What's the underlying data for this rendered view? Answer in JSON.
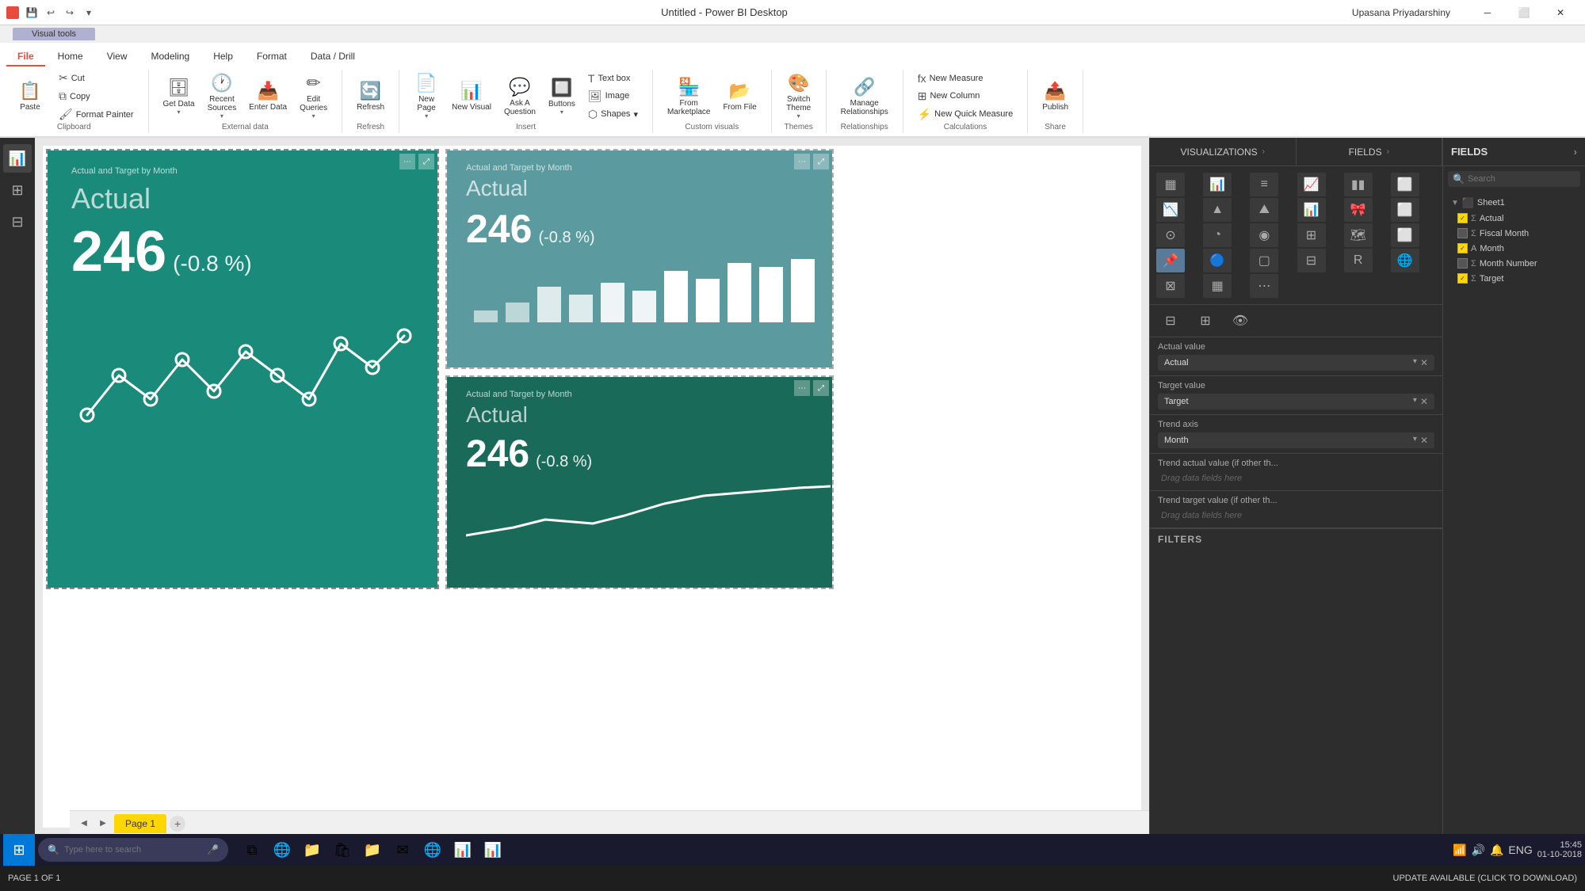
{
  "titlebar": {
    "app_icon": "⬛",
    "title": "Untitled - Power BI Desktop",
    "quick_access": [
      "💾",
      "↩",
      "↪",
      "▾"
    ],
    "visual_tools_tab": "Visual tools",
    "win_min": "─",
    "win_max": "⬜",
    "win_close": "✕",
    "user": "Upasana Priyadarshiny"
  },
  "ribbon_tabs": [
    "File",
    "Home",
    "View",
    "Modeling",
    "Help",
    "Format",
    "Data / Drill"
  ],
  "ribbon_active_tab": "Home",
  "ribbon_groups": {
    "clipboard": {
      "label": "Clipboard",
      "paste": "Paste",
      "cut": "Cut",
      "copy": "Copy",
      "format_painter": "Format Painter"
    },
    "external_data": {
      "label": "External data",
      "get_data": "Get Data",
      "recent_sources": "Recent Sources",
      "enter_data": "Enter Data",
      "edit_queries": "Edit Queries"
    },
    "refresh": {
      "label": "Refresh",
      "btn": "Refresh"
    },
    "insert": {
      "label": "Insert",
      "new_page": "New Page",
      "new_visual": "New Visual",
      "ask_question": "Ask A Question",
      "buttons": "Buttons",
      "text_box": "Text box",
      "image": "Image",
      "shapes": "Shapes"
    },
    "custom_visuals": {
      "label": "Custom visuals",
      "from_marketplace": "From Marketplace",
      "from_file": "From File"
    },
    "themes": {
      "label": "Themes",
      "switch_theme": "Switch Theme"
    },
    "relationships": {
      "label": "Relationships",
      "manage": "Manage Relationships"
    },
    "calculations": {
      "label": "Calculations",
      "new_measure": "New Measure",
      "new_column": "New Column",
      "new_quick_measure": "New Quick Measure"
    },
    "share": {
      "label": "Share",
      "publish": "Publish"
    }
  },
  "charts": {
    "chart1": {
      "title": "Actual and Target by Month",
      "metric_label": "Actual",
      "value": "246",
      "pct": "(-0.8 %)"
    },
    "chart2": {
      "title": "Actual and Target by Month",
      "metric_label": "Actual",
      "value": "246",
      "pct": "(-0.8 %)"
    },
    "chart3": {
      "title": "Actual and Target by Month",
      "metric_label": "Actual",
      "value": "246",
      "pct": "(-0.8 %)"
    }
  },
  "visualizations": {
    "panel_label": "VISUALIZATIONS",
    "expand_icon": "›",
    "icons": [
      "📊",
      "📈",
      "📋",
      "📉",
      "▦",
      "≡",
      "🔵",
      "⬤",
      "⬜",
      "📦",
      "🗺",
      "⊞",
      "R",
      "🌐",
      "⊟",
      "📌",
      "⬚",
      "▦",
      "≋",
      "🗃",
      "📊",
      "✦"
    ],
    "bottom_icons": [
      "⊟",
      "⊞",
      "👁"
    ],
    "actual_value_label": "Actual value",
    "actual_value_field": "Actual",
    "target_value_label": "Target value",
    "target_value_field": "Target",
    "trend_axis_label": "Trend axis",
    "trend_axis_field": "Month",
    "trend_actual_label": "Trend actual value (if other th...",
    "trend_actual_placeholder": "Drag data fields here",
    "trend_target_label": "Trend target value (if other th...",
    "trend_target_placeholder": "Drag data fields here"
  },
  "fields_panel": {
    "label": "FIELDS",
    "expand_icon": "›",
    "search_placeholder": "Search",
    "tree": {
      "sheet1_label": "Sheet1",
      "items": [
        {
          "name": "Actual",
          "checked": true,
          "type": "sigma"
        },
        {
          "name": "Fiscal Month",
          "checked": false,
          "type": "sigma"
        },
        {
          "name": "Month",
          "checked": true,
          "type": "text"
        },
        {
          "name": "Month Number",
          "checked": false,
          "type": "sigma"
        },
        {
          "name": "Target",
          "checked": true,
          "type": "sigma"
        }
      ]
    }
  },
  "filters_label": "FILTERS",
  "page_bar": {
    "page_label": "Page 1",
    "add_page_icon": "+"
  },
  "status_bar": {
    "page_info": "PAGE 1 OF 1",
    "update_msg": "UPDATE AVAILABLE (CLICK TO DOWNLOAD)"
  },
  "taskbar": {
    "search_placeholder": "Type here to search",
    "time": "15:45",
    "date": "01-10-2018",
    "apps": [
      "🌐",
      "📁",
      "🛍",
      "📁",
      "✉",
      "🌐",
      "📊",
      "📊"
    ]
  },
  "colors": {
    "chart1_bg": "#1a8a7a",
    "chart2_bg": "#5b9ba0",
    "chart3_bg": "#1a6a5a",
    "titlebar_bg": "#ffffff",
    "ribbon_bg": "#ffffff",
    "sidebar_bg": "#2d2d2d",
    "panel_bg": "#2d2d2d",
    "status_bg": "#1e1e1e",
    "taskbar_bg": "#1a1a2e",
    "active_tab": "#e74c3c"
  }
}
